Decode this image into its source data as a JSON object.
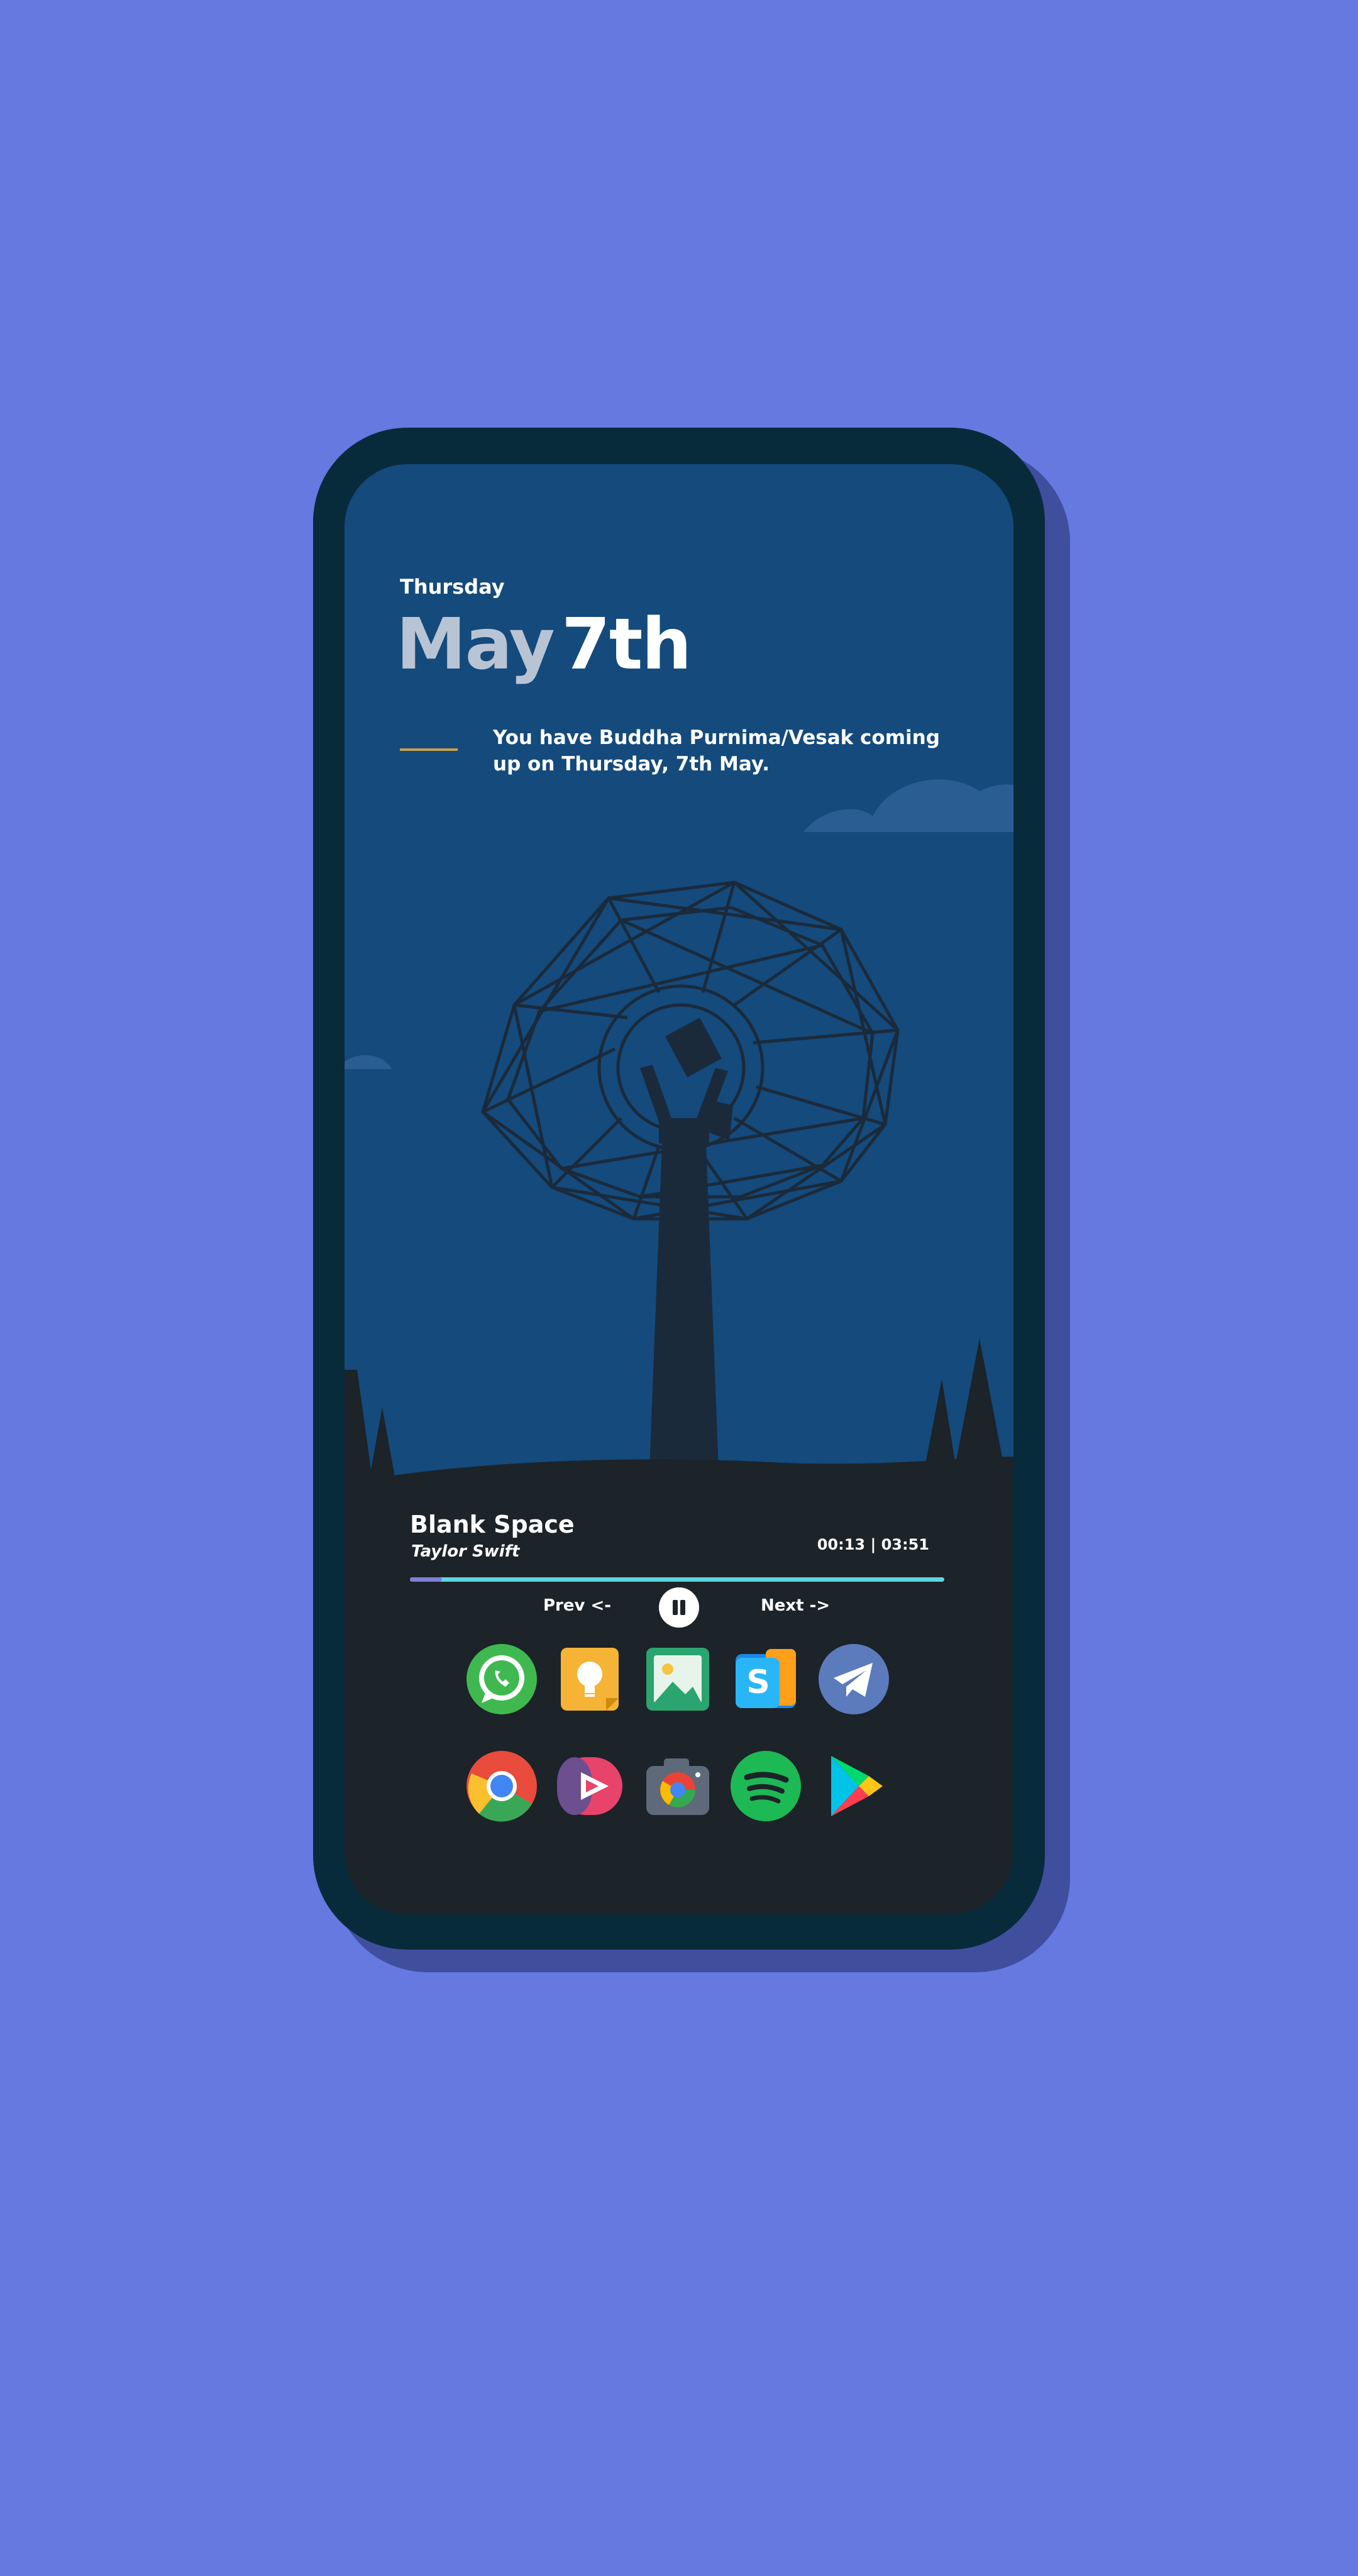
{
  "clock": {
    "day": "Thursday",
    "month": "May",
    "date": "7th"
  },
  "event": {
    "text": "You have Buddha Purnima/Vesak coming up on Thursday, 7th May."
  },
  "music": {
    "title": "Blank Space",
    "artist": "Taylor Swift",
    "time": "00:13 | 03:51",
    "progress": 0.06,
    "prev_label": "Prev <-",
    "next_label": "Next ->"
  },
  "dock": {
    "row1": [
      {
        "icon": "whatsapp-icon"
      },
      {
        "icon": "keep-notes-icon"
      },
      {
        "icon": "gallery-icon"
      },
      {
        "icon": "files-icon"
      },
      {
        "icon": "telegram-icon"
      }
    ],
    "row2": [
      {
        "icon": "chrome-icon"
      },
      {
        "icon": "video-player-icon"
      },
      {
        "icon": "camera-icon"
      },
      {
        "icon": "spotify-icon"
      },
      {
        "icon": "play-store-icon"
      }
    ]
  },
  "colors": {
    "background": "#6579e0",
    "sky": "#144a7c",
    "ground": "#1c2329",
    "progress_track": "#5bd7e0",
    "progress_fill": "#7d7fd8",
    "accent_divider": "#c6a24a"
  }
}
